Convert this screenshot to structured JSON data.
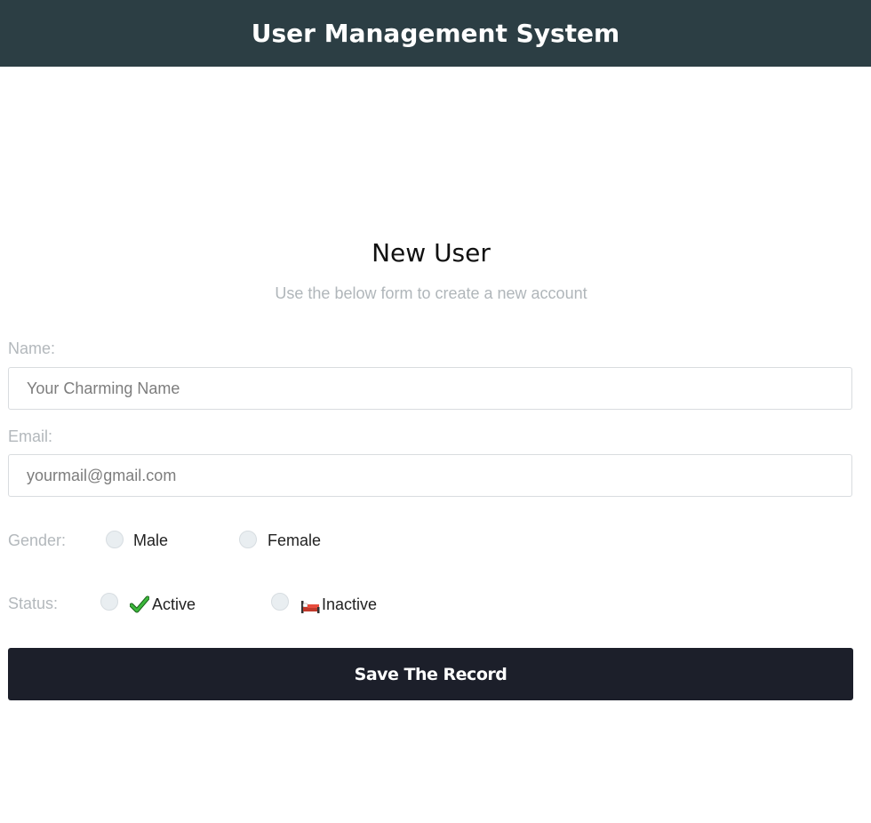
{
  "header": {
    "title": "User Management System"
  },
  "form": {
    "title": "New User",
    "subtitle": "Use the below form to create a new account",
    "name": {
      "label": "Name:",
      "placeholder": "Your Charming Name",
      "value": ""
    },
    "email": {
      "label": "Email:",
      "placeholder": "yourmail@gmail.com",
      "value": ""
    },
    "gender": {
      "label": "Gender:",
      "options": [
        "Male",
        "Female"
      ],
      "selected": null
    },
    "status": {
      "label": "Status:",
      "options": [
        {
          "label": "Active",
          "icon": "checkmark-icon"
        },
        {
          "label": "Inactive",
          "icon": "bed-icon"
        }
      ],
      "selected": null
    },
    "submit_label": "Save The Record"
  },
  "colors": {
    "header_bg": "#2c3e44",
    "button_bg": "#1c1f2a",
    "label_text": "#b3b8bc",
    "check_green": "#2e9e2e"
  }
}
